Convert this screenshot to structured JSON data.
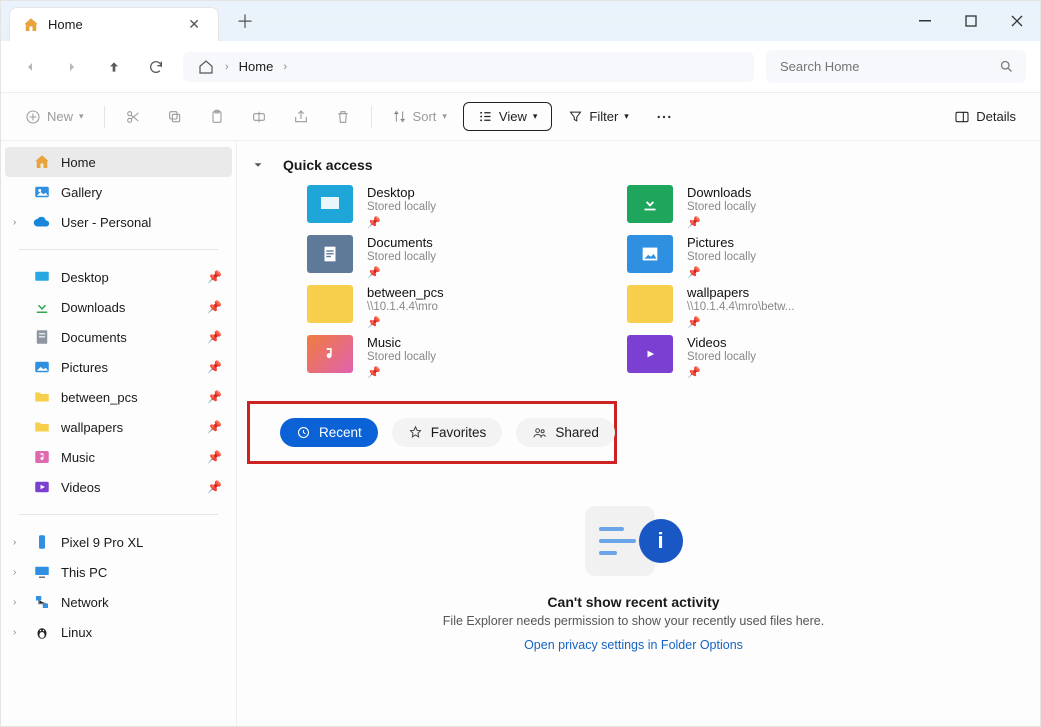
{
  "titlebar": {
    "tab_title": "Home"
  },
  "addressbar": {
    "crumb": "Home"
  },
  "search": {
    "placeholder": "Search Home"
  },
  "toolbar": {
    "new": "New",
    "sort": "Sort",
    "view": "View",
    "filter": "Filter",
    "details": "Details"
  },
  "sidebar": {
    "top": [
      {
        "label": "Home"
      },
      {
        "label": "Gallery"
      },
      {
        "label": "User - Personal"
      }
    ],
    "pins": [
      {
        "label": "Desktop"
      },
      {
        "label": "Downloads"
      },
      {
        "label": "Documents"
      },
      {
        "label": "Pictures"
      },
      {
        "label": "between_pcs"
      },
      {
        "label": "wallpapers"
      },
      {
        "label": "Music"
      },
      {
        "label": "Videos"
      }
    ],
    "bottom": [
      {
        "label": "Pixel 9 Pro XL"
      },
      {
        "label": "This PC"
      },
      {
        "label": "Network"
      },
      {
        "label": "Linux"
      }
    ]
  },
  "quick": {
    "heading": "Quick access",
    "items": [
      {
        "name": "Desktop",
        "sub": "Stored locally"
      },
      {
        "name": "Downloads",
        "sub": "Stored locally"
      },
      {
        "name": "Documents",
        "sub": "Stored locally"
      },
      {
        "name": "Pictures",
        "sub": "Stored locally"
      },
      {
        "name": "between_pcs",
        "sub": "\\\\10.1.4.4\\mro"
      },
      {
        "name": "wallpapers",
        "sub": "\\\\10.1.4.4\\mro\\betw..."
      },
      {
        "name": "Music",
        "sub": "Stored locally"
      },
      {
        "name": "Videos",
        "sub": "Stored locally"
      }
    ]
  },
  "pills": {
    "recent": "Recent",
    "favorites": "Favorites",
    "shared": "Shared"
  },
  "empty": {
    "title": "Can't show recent activity",
    "sub": "File Explorer needs permission to show your recently used files here.",
    "link": "Open privacy settings in Folder Options"
  }
}
